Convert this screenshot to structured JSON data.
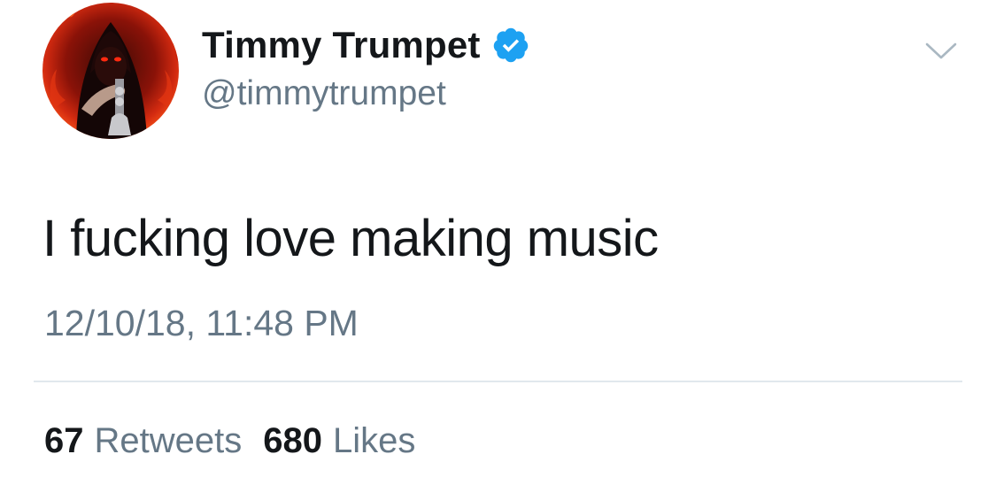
{
  "author": {
    "display_name": "Timmy Trumpet",
    "handle": "@timmytrumpet",
    "verified": true,
    "avatar_icon": "profile-photo-hooded-trumpeter",
    "verified_icon": "verified-badge-icon"
  },
  "tweet": {
    "text": "I fucking love making music",
    "timestamp": "12/10/18, 11:48 PM"
  },
  "stats": {
    "retweets_count": "67",
    "retweets_label": "Retweets",
    "likes_count": "680",
    "likes_label": "Likes"
  },
  "menu": {
    "icon": "chevron-down-icon"
  },
  "colors": {
    "text_primary": "#14171a",
    "text_secondary": "#657786",
    "verified_blue": "#1da1f2",
    "divider": "#e1e8ed"
  }
}
